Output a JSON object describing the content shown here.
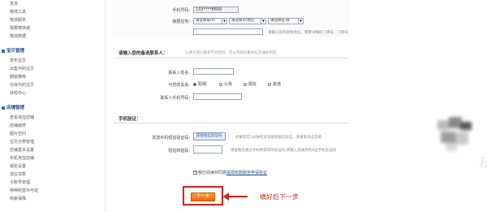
{
  "sidebar": {
    "items_top": [
      "发货",
      "物流工具",
      "物流服务",
      "我要寄快递",
      "物流数据"
    ],
    "section1": {
      "title": "宝贝管理",
      "items": [
        "发布宝贝",
        "出售中的宝贝",
        "橱窗推荐",
        "仓库中的宝贝",
        "体检中心"
      ]
    },
    "section2": {
      "title": "店铺管理",
      "items": [
        "查看淘宝店铺",
        "店铺装修",
        "图片空间",
        "宝贝分类管理",
        "店铺基本设置",
        "手机淘宝店铺",
        "域名设置",
        "淘宝贷款",
        "子账号管理",
        "特种经营许可证",
        "商家保障"
      ]
    }
  },
  "form": {
    "phone": {
      "label": "手机号码:",
      "value": "133****8656"
    },
    "address": {
      "label": "我居住地:",
      "province": "请选择省/市",
      "city": "请选择市/地区",
      "district": "请选择区/县",
      "hint": "请输入您的居住地址，需要详细的门牌号，门牌号"
    },
    "backup_section": {
      "title": "请输入您的备选联系人：",
      "note": "以便于我们联系不到您时，可以用您的服务信息通知到您"
    },
    "contact_name": {
      "label": "联系人姓名:"
    },
    "relation": {
      "label": "与您的关系:",
      "options": [
        "配偶",
        "父母",
        "朋友",
        "其他"
      ],
      "selected": 0
    },
    "contact_phone": {
      "label": "联系人手机号码:"
    },
    "verify_section": {
      "title": "手机验证："
    },
    "send_code": {
      "label": "发送手机短信验证码:",
      "button": "获取短信验证码",
      "hint": "如果您在1分钟内没有收到短信验证，请重新点击获取"
    },
    "code": {
      "label": "短信校验码:",
      "hint": "请查看您通过手机所获得的验证码,并输入您收到的6位手机验证码"
    },
    "agree": {
      "text": "我已阅读并同意",
      "link": "提现收款服务申请协议"
    },
    "next_button": "下一步"
  },
  "annotation": "填好后下一步",
  "watermark": "Ba"
}
